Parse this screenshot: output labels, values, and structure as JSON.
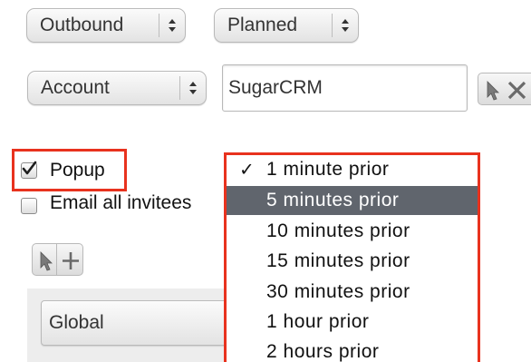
{
  "row1": {
    "direction_select": "Outbound",
    "status_select": "Planned"
  },
  "row2": {
    "parent_type_select": "Account",
    "parent_name_value": "SugarCRM"
  },
  "reminders": {
    "popup_label": "Popup",
    "popup_checked": true,
    "email_label": "Email all invitees",
    "email_checked": false
  },
  "popup_timing_menu": {
    "options": [
      "1 minute prior",
      "5 minutes prior",
      "10 minutes prior",
      "15 minutes prior",
      "30 minutes prior",
      "1 hour prior",
      "2 hours prior"
    ],
    "checked_option": "1 minute prior",
    "highlighted_option": "5 minutes prior",
    "check_mark": "✓"
  },
  "teams": {
    "team_select": "Global"
  },
  "colors": {
    "annotation": "#e8321e",
    "menu_highlight": "#60656d"
  }
}
